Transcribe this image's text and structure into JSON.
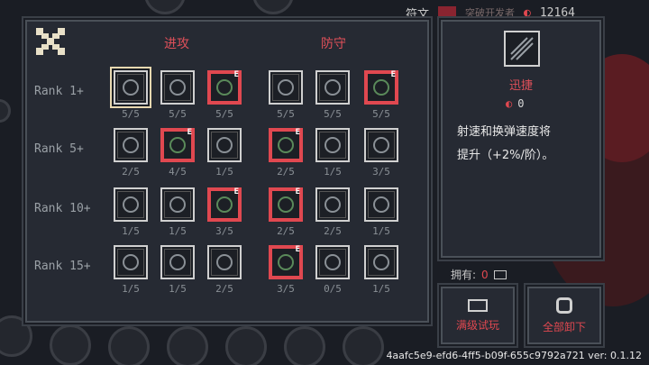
{
  "top_bar": {
    "rune_tab": "符文",
    "muted_label": "突破开发者",
    "currency": "12164"
  },
  "columns": {
    "attack": "进攻",
    "defense": "防守"
  },
  "ranks": [
    {
      "label": "Rank 1+",
      "runes": [
        {
          "name": "swift",
          "count": "5/5",
          "equipped": false,
          "selected": true
        },
        {
          "name": "vortex",
          "count": "5/5",
          "equipped": false
        },
        {
          "name": "fist",
          "count": "5/5",
          "equipped": true
        },
        {
          "name": "shield-ward",
          "count": "5/5",
          "equipped": false
        },
        {
          "name": "figure",
          "count": "5/5",
          "equipped": false
        },
        {
          "name": "eye-shield",
          "count": "5/5",
          "equipped": true
        }
      ]
    },
    {
      "label": "Rank 5+",
      "runes": [
        {
          "name": "spread",
          "count": "2/5",
          "equipped": false
        },
        {
          "name": "claw",
          "count": "4/5",
          "equipped": true
        },
        {
          "name": "waves",
          "count": "1/5",
          "equipped": false
        },
        {
          "name": "ring",
          "count": "2/5",
          "equipped": true
        },
        {
          "name": "boot",
          "count": "1/5",
          "equipped": false
        },
        {
          "name": "leaf",
          "count": "3/5",
          "equipped": false
        }
      ]
    },
    {
      "label": "Rank 10+",
      "runes": [
        {
          "name": "fireball",
          "count": "1/5",
          "equipped": false
        },
        {
          "name": "sigil",
          "count": "1/5",
          "equipped": false
        },
        {
          "name": "burst",
          "count": "3/5",
          "equipped": true
        },
        {
          "name": "orb",
          "count": "2/5",
          "equipped": true
        },
        {
          "name": "hearts",
          "count": "2/5",
          "equipped": false
        },
        {
          "name": "grave",
          "count": "1/5",
          "equipped": false
        }
      ]
    },
    {
      "label": "Rank 15+",
      "runes": [
        {
          "name": "comet",
          "count": "1/5",
          "equipped": false
        },
        {
          "name": "beast",
          "count": "1/5",
          "equipped": false
        },
        {
          "name": "arrows",
          "count": "2/5",
          "equipped": false
        },
        {
          "name": "holy-heart",
          "count": "3/5",
          "equipped": true
        },
        {
          "name": "angel",
          "count": "0/5",
          "equipped": false
        },
        {
          "name": "demon",
          "count": "1/5",
          "equipped": false
        }
      ]
    }
  ],
  "badge_letter": "E",
  "detail": {
    "name": "迅捷",
    "cost": "0",
    "desc_line1": "射速和换弹速度将",
    "desc_line2": "提升（+2%/阶）。"
  },
  "owned": {
    "label": "拥有:",
    "value": "0"
  },
  "buttons": {
    "trial": "满级试玩",
    "unequip_all": "全部卸下"
  },
  "footer": "4aafc5e9-efd6-4ff5-b09f-655c9792a721 ver: 0.1.12",
  "colors": {
    "accent": "#e04850",
    "panel": "#262a33",
    "border": "#4a5058"
  }
}
